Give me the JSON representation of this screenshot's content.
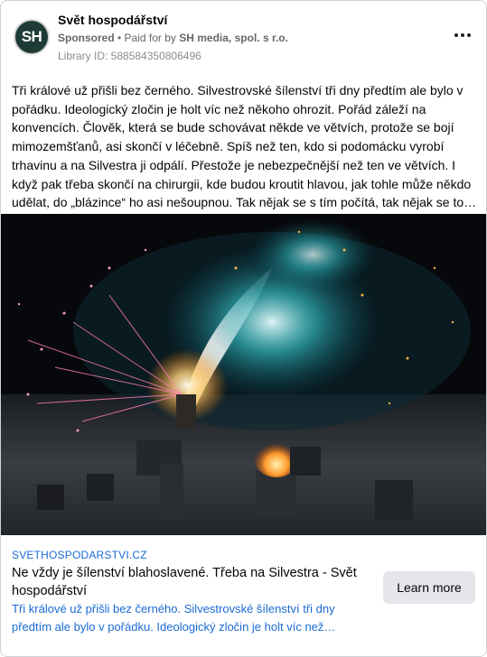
{
  "post": {
    "page_name": "Svět hospodářství",
    "avatar_initials": "SH",
    "sponsored": "Sponsored",
    "separator": " • ",
    "paid_for_prefix": "Paid for by ",
    "advertiser": "SH media, spol. s r.o.",
    "library_id": "Library ID: 588584350806496",
    "body": "Tři králové už přišli bez černého. Silvestrovské šílenství tři dny předtím ale bylo v pořádku. Ideologický zločin je holt víc než někoho ohrozit. Pořád záleží na konvencích. Člověk, která se bude schovávat někde ve větvích, protože se bojí mimozemšťanů, asi skončí v léčebně. Spíš než ten, kdo si podomácku vyrobí trhavinu a na Silvestra ji odpálí. Přestože je nebezpečnější než ten ve větvích. I když pak třeba skončí na chirurgii, kde budou kroutit hlavou, jak tohle může někdo udělat, do „blázince“ ho asi nešoupnou. Tak nějak se s tím počítá, tak nějak se to…"
  },
  "media": {
    "image_name": "firework-fountain-photo"
  },
  "link": {
    "domain": "SVETHOSPODARSTVI.CZ",
    "headline": "Ne vždy je šílenství blahoslavené. Třeba na Silvestra - Svět hospodářství",
    "description": "Tři králové už přišli bez černého. Silvestrovské šílenství tři dny předtím ale bylo v pořádku. Ideologický zločin je holt víc než…",
    "cta_label": "Learn more"
  },
  "colors": {
    "link_blue": "#1a6bd3",
    "secondary_text": "#65676b",
    "button_bg": "#e4e6eb"
  }
}
